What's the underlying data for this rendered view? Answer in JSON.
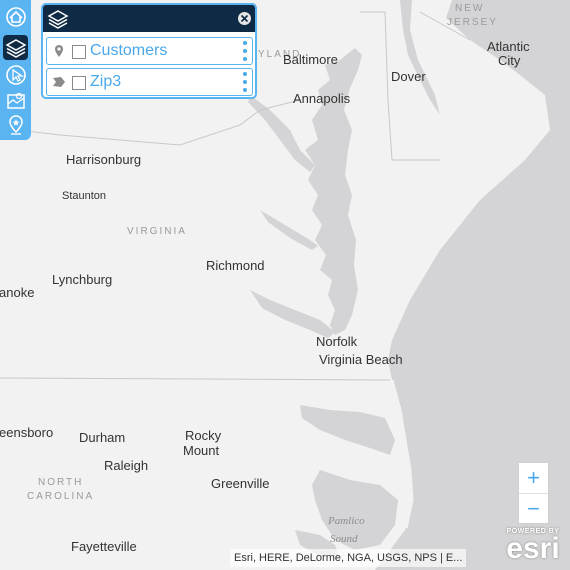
{
  "map": {
    "city_labels": [
      {
        "id": "baltimore",
        "text": "Baltimore"
      },
      {
        "id": "dover",
        "text": "Dover"
      },
      {
        "id": "atlantic-city-1",
        "text": "Atlantic"
      },
      {
        "id": "atlantic-city-2",
        "text": "City"
      },
      {
        "id": "annapolis",
        "text": "Annapolis"
      },
      {
        "id": "harrisonburg",
        "text": "Harrisonburg"
      },
      {
        "id": "staunton",
        "text": "Staunton"
      },
      {
        "id": "richmond",
        "text": "Richmond"
      },
      {
        "id": "lynchburg",
        "text": "Lynchburg"
      },
      {
        "id": "roanoke",
        "text": "anoke"
      },
      {
        "id": "norfolk",
        "text": "Norfolk"
      },
      {
        "id": "virginia-beach",
        "text": "Virginia Beach"
      },
      {
        "id": "greensboro",
        "text": "eensboro"
      },
      {
        "id": "durham",
        "text": "Durham"
      },
      {
        "id": "rocky-mount-1",
        "text": "Rocky"
      },
      {
        "id": "rocky-mount-2",
        "text": "Mount"
      },
      {
        "id": "raleigh",
        "text": "Raleigh"
      },
      {
        "id": "greenville",
        "text": "Greenville"
      },
      {
        "id": "fayetteville",
        "text": "Fayetteville"
      }
    ],
    "state_labels": {
      "new_jersey_1": "NEW",
      "new_jersey_2": "JERSEY",
      "maryland": "YLAND",
      "virginia": "VIRGINIA",
      "north_carolina_1": "NORTH",
      "north_carolina_2": "CAROLINA"
    },
    "water_labels": {
      "pamlico_1": "Pamlico",
      "pamlico_2": "Sound"
    },
    "colors": {
      "land": "#f2f2f2",
      "water": "#d4d4d6",
      "border": "#c8c8c8",
      "accent": "#5ab4f2",
      "header": "#0f2a44"
    }
  },
  "toolbar": {
    "tools": [
      {
        "icon": "home-icon"
      },
      {
        "icon": "layers-icon",
        "active": true
      },
      {
        "icon": "select-cursor-icon"
      },
      {
        "icon": "map-gallery-icon"
      },
      {
        "icon": "location-pin-icon"
      }
    ]
  },
  "layer_panel": {
    "icon": "layers-icon",
    "close_icon": "close-icon",
    "layers": [
      {
        "name": "Customers",
        "geometry_icon": "point-pin-icon",
        "checked": false
      },
      {
        "name": "Zip3",
        "geometry_icon": "polygon-icon",
        "checked": false
      }
    ]
  },
  "zoom": {
    "in_label": "+",
    "out_label": "−"
  },
  "attribution": "Esri, HERE, DeLorme, NGA, USGS, NPS | E...",
  "esri_logo": {
    "powered": "POWERED BY",
    "brand": "esri"
  }
}
